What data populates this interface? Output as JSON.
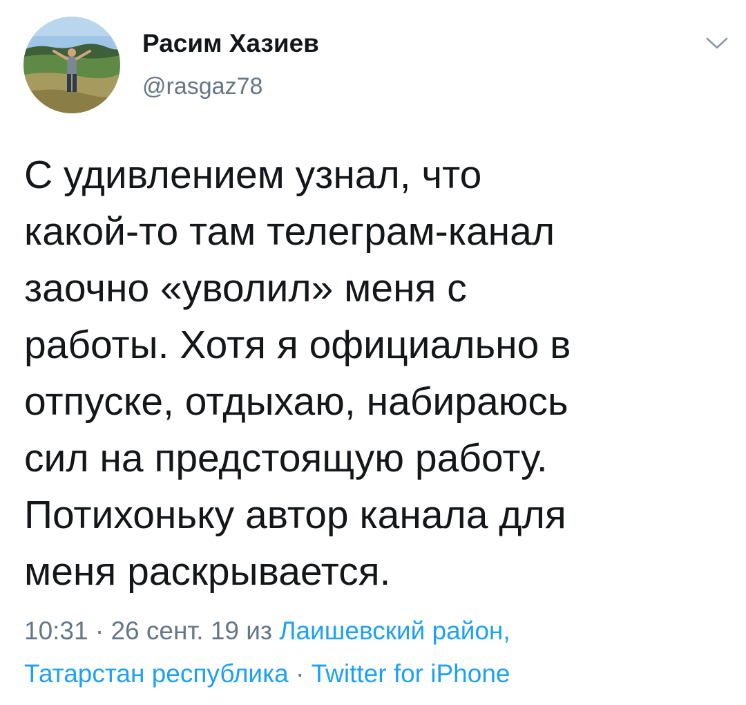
{
  "author": {
    "name": "Расим Хазиев",
    "handle": "@rasgaz78"
  },
  "tweet": {
    "lines": [
      "С удивлением узнал, что",
      "какой-то там телеграм-канал",
      "заочно «уволил» меня с",
      "работы. Хотя я официально в",
      "отпуске, отдыхаю, набираюсь",
      "сил на предстоящую работу.",
      "Потихоньку автор канала для",
      "меня раскрывается."
    ]
  },
  "meta": {
    "time": "10:31",
    "separator": " · ",
    "date": "26 сент. 19",
    "from_word": " из ",
    "location_line1": "Лаишевский район,",
    "location_line2": "Татарстан республика",
    "source": "Twitter for iPhone"
  },
  "colors": {
    "text": "#14171a",
    "secondary": "#657786",
    "link": "#1da1f2",
    "background": "#ffffff"
  },
  "icons": {
    "menu": "chevron-down-icon",
    "avatar": "avatar-photo"
  }
}
